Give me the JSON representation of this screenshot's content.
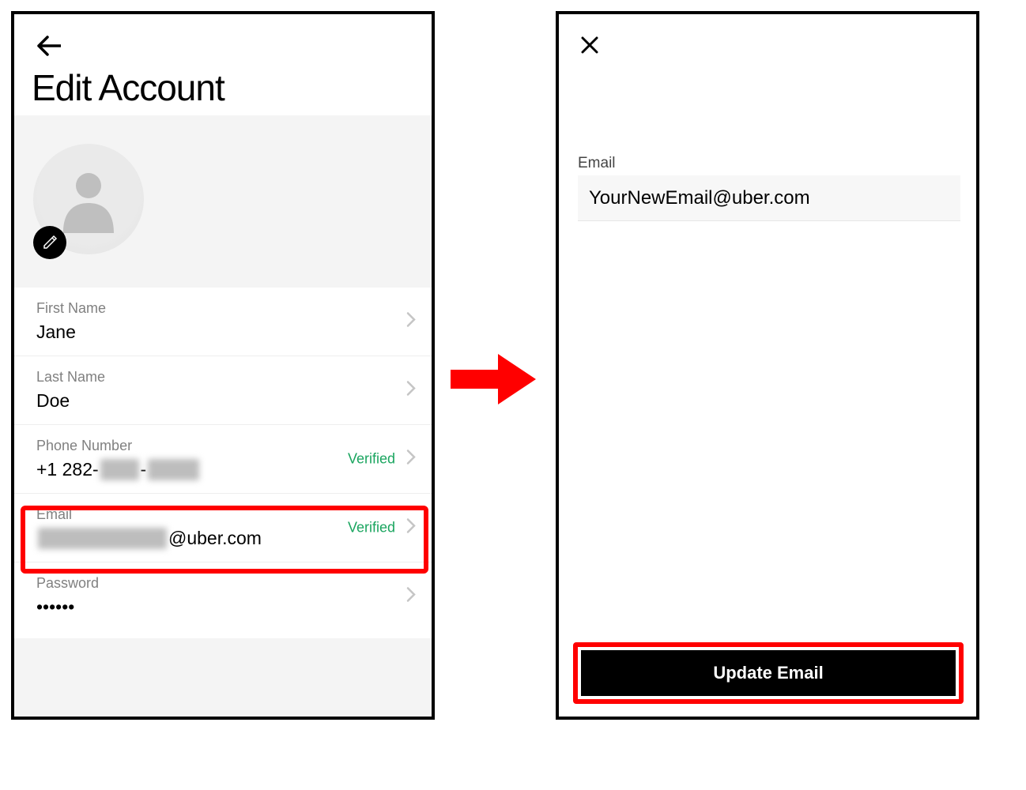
{
  "left": {
    "title": "Edit Account",
    "fields": {
      "first_name": {
        "label": "First Name",
        "value": "Jane"
      },
      "last_name": {
        "label": "Last Name",
        "value": "Doe"
      },
      "phone": {
        "label": "Phone Number",
        "value_prefix": "+1 282-",
        "value_redacted1": "███",
        "value_mid": "-",
        "value_redacted2": "████",
        "status": "Verified"
      },
      "email": {
        "label": "Email",
        "value_redacted": "██████████",
        "value_suffix": "@uber.com",
        "status": "Verified"
      },
      "password": {
        "label": "Password",
        "value": "••••••"
      }
    }
  },
  "right": {
    "email_label": "Email",
    "email_value": "YourNewEmail@uber.com",
    "update_button": "Update Email"
  }
}
